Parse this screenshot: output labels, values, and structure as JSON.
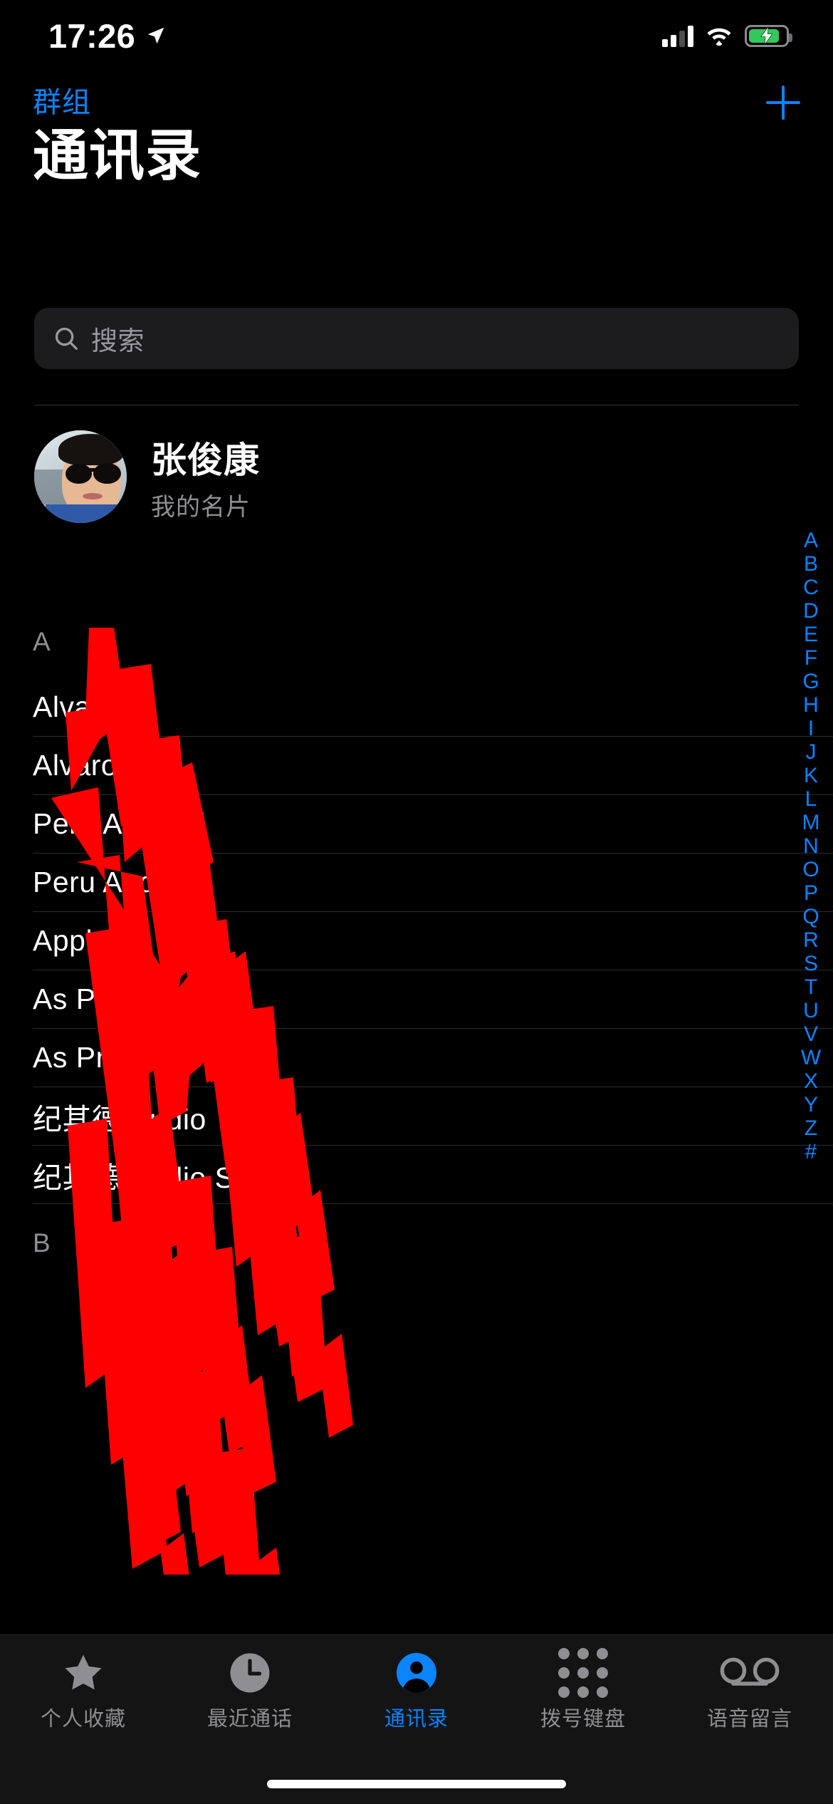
{
  "status_bar": {
    "time": "17:26",
    "location_icon": "location-arrow-icon",
    "cellular_icon": "cellular-signal-icon",
    "wifi_icon": "wifi-icon",
    "battery_icon": "battery-charging-icon",
    "battery_charging": true
  },
  "nav": {
    "groups_label": "群组",
    "add_label": "+"
  },
  "header": {
    "title": "通讯录"
  },
  "search": {
    "placeholder": "搜索",
    "value": "",
    "icon": "search-icon"
  },
  "my_card": {
    "name": "张俊康",
    "subtitle": "我的名片",
    "avatar": "user-avatar-photo"
  },
  "contacts": {
    "sections": [
      {
        "letter": "A",
        "rows": [
          {
            "name": "Alvaro"
          },
          {
            "name": "Alvaro"
          },
          {
            "name": "Peru Android"
          },
          {
            "name": "Peru Android"
          },
          {
            "name": "Apple ("
          },
          {
            "name": "As Pro audio"
          },
          {
            "name": "As Pro audio"
          },
          {
            "name": "纪其德 Audio"
          },
          {
            "name": "纪其德 Audio Stream"
          }
        ]
      },
      {
        "letter": "B",
        "rows": []
      }
    ]
  },
  "alphabet_index": {
    "letters": [
      "A",
      "B",
      "C",
      "D",
      "E",
      "F",
      "G",
      "H",
      "I",
      "J",
      "K",
      "L",
      "M",
      "N",
      "O",
      "P",
      "Q",
      "R",
      "S",
      "T",
      "U",
      "V",
      "W",
      "X",
      "Y",
      "Z",
      "#"
    ],
    "color": "#0a84ff"
  },
  "tab_bar": {
    "items": [
      {
        "label": "个人收藏",
        "icon": "star-icon",
        "active": false
      },
      {
        "label": "最近通话",
        "icon": "clock-icon",
        "active": false
      },
      {
        "label": "通讯录",
        "icon": "person-icon",
        "active": true
      },
      {
        "label": "拨号键盘",
        "icon": "keypad-icon",
        "active": false
      },
      {
        "label": "语音留言",
        "icon": "voicemail-icon",
        "active": false
      }
    ]
  },
  "colors": {
    "accent": "#0a84ff",
    "background": "#000000",
    "secondary_text": "#8e8e93",
    "search_field": "#1c1c1e",
    "separator": "#2b2b2d",
    "tab_bar": "#141414",
    "redaction": "#ff0000",
    "battery_green": "#34c759"
  }
}
